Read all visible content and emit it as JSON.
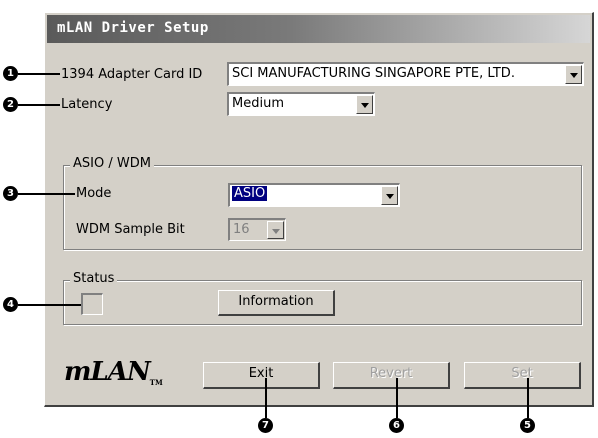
{
  "window": {
    "title": "mLAN Driver Setup"
  },
  "adapter": {
    "label": "1394 Adapter Card ID",
    "value": "SCI MANUFACTURING SINGAPORE PTE, LTD."
  },
  "latency": {
    "label": "Latency",
    "value": "Medium"
  },
  "asio_group": {
    "title": "ASIO / WDM",
    "mode_label": "Mode",
    "mode_value": "ASIO",
    "sample_bit_label": "WDM Sample Bit",
    "sample_bit_value": "16"
  },
  "status_group": {
    "title": "Status",
    "info_button": "Information"
  },
  "footer": {
    "logo_text": "mLAN",
    "exit_button": "Exit",
    "revert_button": "Revert",
    "set_button": "Set"
  },
  "callouts": {
    "adapter": "1",
    "latency": "2",
    "mode": "3",
    "status": "4",
    "set": "5",
    "revert": "6",
    "exit": "7"
  }
}
